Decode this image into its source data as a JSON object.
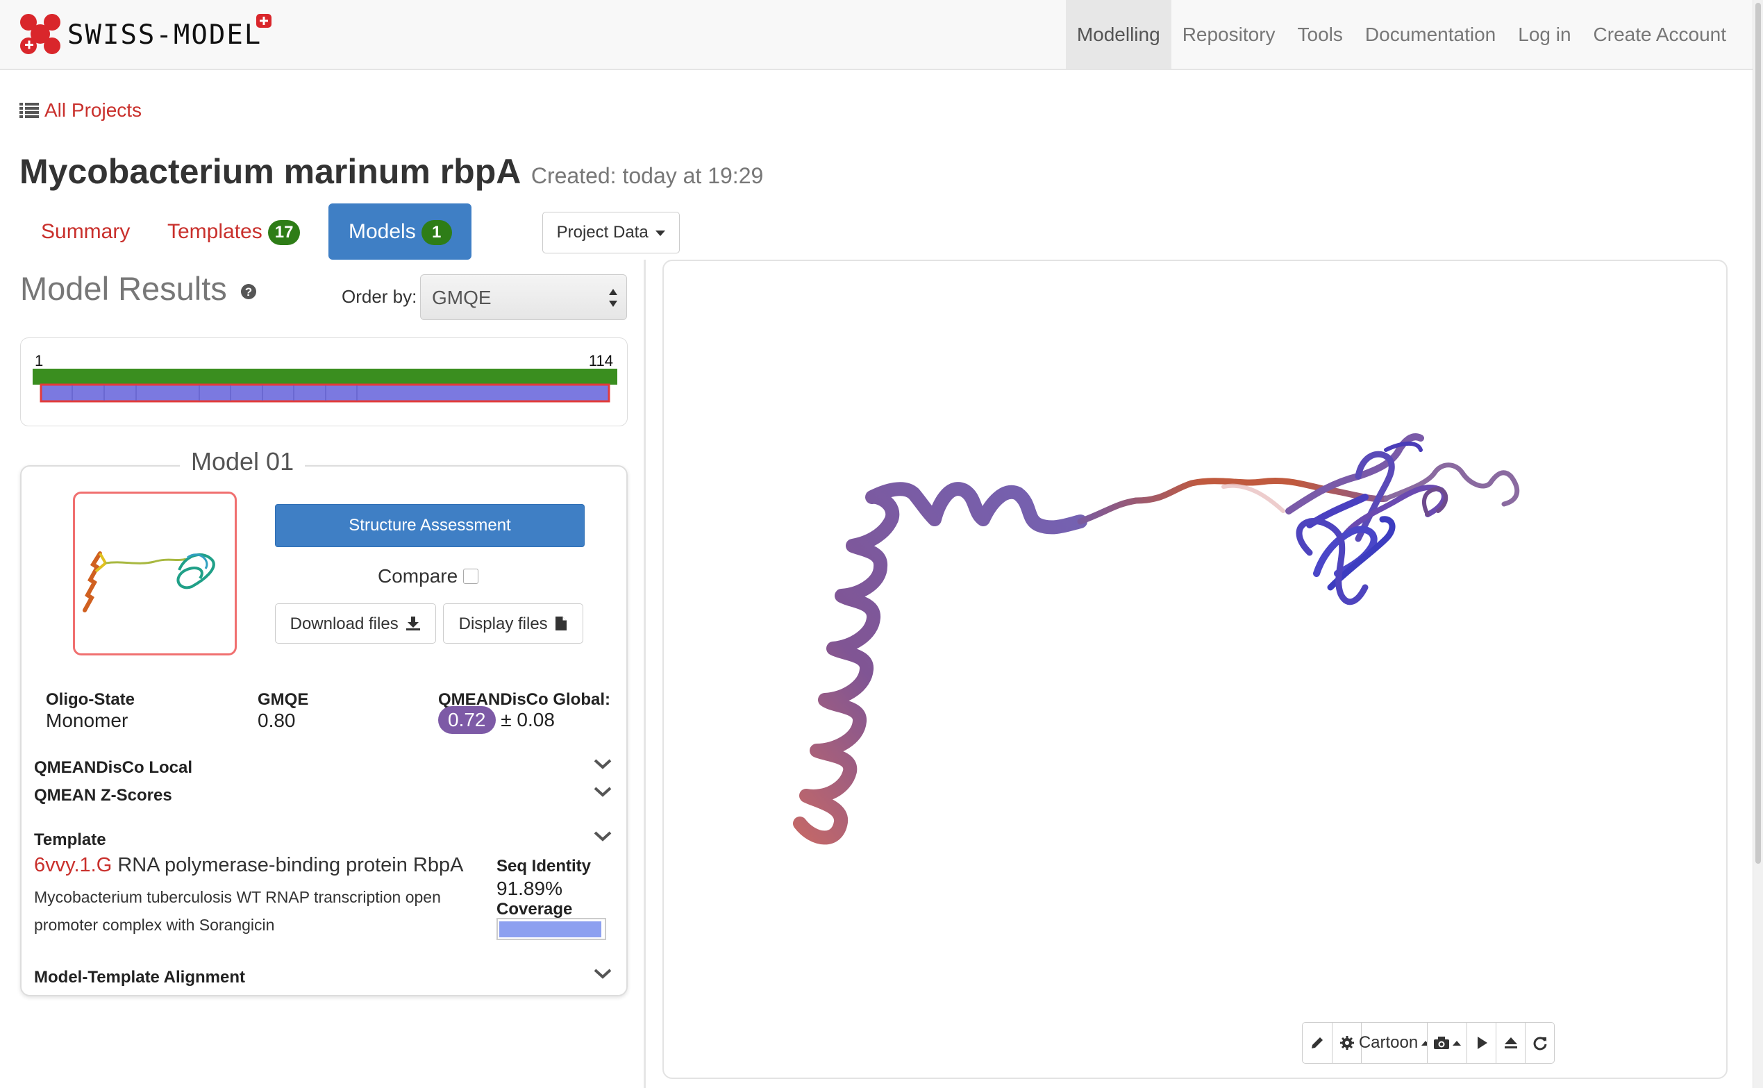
{
  "navbar": {
    "logo_text": "SWISS-MODEL",
    "items": [
      {
        "label": "Modelling",
        "active": true
      },
      {
        "label": "Repository",
        "active": false
      },
      {
        "label": "Tools",
        "active": false
      },
      {
        "label": "Documentation",
        "active": false
      },
      {
        "label": "Log in",
        "active": false
      },
      {
        "label": "Create Account",
        "active": false
      }
    ]
  },
  "breadcrumb": {
    "label": "All Projects",
    "icon": "list-icon"
  },
  "project": {
    "name": "Mycobacterium marinum rbpA",
    "created": "Created: today at 19:29"
  },
  "tabs": [
    {
      "label": "Summary",
      "badge": null,
      "active": false
    },
    {
      "label": "Templates",
      "badge": "17",
      "active": false
    },
    {
      "label": "Models",
      "badge": "1",
      "active": true
    }
  ],
  "project_data_button": "Project Data",
  "results": {
    "title": "Model Results",
    "help_icon": "question-circle-icon",
    "order_label": "Order by:",
    "order_value": "GMQE"
  },
  "coverage": {
    "start": "1",
    "end": "114",
    "target_color": "#3a8e1f",
    "model_color": "#7b79e0",
    "border_color": "#e23b3b"
  },
  "model": {
    "title": "Model 01",
    "structure_assessment": "Structure Assessment",
    "compare_label": "Compare",
    "download_label": "Download files",
    "display_label": "Display files",
    "oligo_state_label": "Oligo-State",
    "oligo_state": "Monomer",
    "gmqe_label": "GMQE",
    "gmqe": "0.80",
    "qmean_label": "QMEANDisCo Global:",
    "qmean_value": "0.72",
    "qmean_error": "± 0.08",
    "qmean_pill_color": "#7d5aa6",
    "sections": {
      "local": "QMEANDisCo Local",
      "zscores": "QMEAN Z-Scores",
      "template": "Template",
      "alignment": "Model-Template Alignment"
    },
    "template_id": "6vvy.1.G",
    "template_name": "RNA polymerase-binding protein RbpA",
    "template_desc": "Mycobacterium tuberculosis WT RNAP transcription open promoter complex with Sorangicin",
    "seq_identity_label": "Seq Identity",
    "seq_identity": "91.89%",
    "coverage_label": "Coverage",
    "coverage_fraction": 0.97
  },
  "viewer": {
    "representation": "Cartoon",
    "tools": [
      "pencil-icon",
      "gear-icon",
      "camera-icon",
      "play-icon",
      "eject-icon",
      "refresh-icon"
    ]
  },
  "colors": {
    "link": "#c9302c",
    "primary": "#3f7fc5",
    "badge": "#2e7d17"
  }
}
